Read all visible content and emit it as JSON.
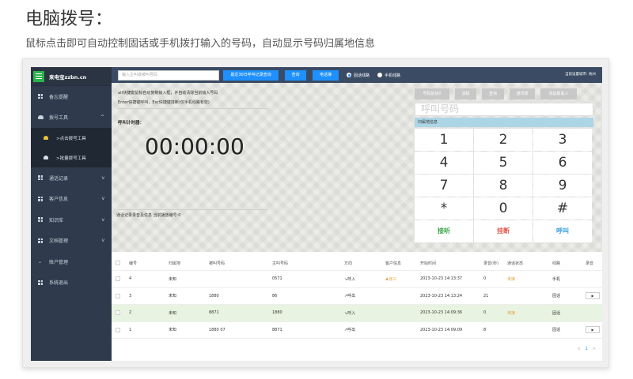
{
  "page": {
    "title": "电脑拨号：",
    "subtitle": "鼠标点击即可自动控制固话或手机拨打输入的号码，自动显示号码归属地信息"
  },
  "app": {
    "brand": "来电宝zzbn.cn",
    "sidebar": [
      {
        "label": "备忘提醒",
        "chev": ""
      },
      {
        "label": "拨号工具",
        "chev": "^"
      },
      {
        "label": ">点击拨号工具",
        "sub": true,
        "active": true
      },
      {
        "label": ">批量拨号工具",
        "sub": true
      },
      {
        "label": "通话记录",
        "chev": "v"
      },
      {
        "label": "客户信息",
        "chev": "v"
      },
      {
        "label": "知识库",
        "chev": "v"
      },
      {
        "label": "文档管理",
        "chev": "v"
      },
      {
        "label": "账户管理",
        "chev": ""
      },
      {
        "label": "系统退出",
        "chev": ""
      }
    ],
    "topbar": {
      "search_placeholder": "输入主叫或被叫号码",
      "btn_recent": "最近30日呼叫记录查询",
      "btn_query": "查询",
      "btn_board": "电话簿",
      "radio_landline": "固话线路",
      "radio_mobile": "手机线路",
      "right_text": "当前设置城市: 杭州"
    },
    "work": {
      "hint1": "alt快捷键鼠标自动复制输入框，并自动清除当前输入号码",
      "hint2": "Enter快捷键呼叫，Esc快捷键挂断(仅手机线路有效)",
      "timer_label": "呼叫计时器：",
      "timer": "00:00:00",
      "rec_info": "通话记录录音及信息 当前播放编号:0"
    },
    "dialpad": {
      "buttons": [
        "号码前加0",
        "清除",
        "查询",
        "通讯录",
        "添加联系人"
      ],
      "input_placeholder": "呼叫号码",
      "region_label": "归属地信息",
      "keys": [
        "1",
        "2",
        "3",
        "4",
        "5",
        "6",
        "7",
        "8",
        "9",
        "*",
        "0",
        "#"
      ],
      "answer": "接听",
      "hangup": "挂断",
      "call": "呼叫"
    },
    "table": {
      "headers": [
        "编号",
        "归属地",
        "被叫号码",
        "主叫号码",
        "方向",
        "客户信息",
        "开始时间",
        "录音(秒)",
        "通话状态",
        "线路",
        "录音"
      ],
      "rows": [
        {
          "no": "4",
          "region": "未知",
          "callee": "",
          "caller": "0571",
          "dir": "↘呼入",
          "customer": "♟张三",
          "start": "2023-10-23 14:13:37",
          "rec": "0",
          "status": "未接",
          "line": "手机",
          "play": ""
        },
        {
          "no": "3",
          "region": "未知",
          "callee": "1880",
          "caller": "86",
          "dir": "↗呼出",
          "customer": "",
          "start": "2023-10-23 14:13:24",
          "rec": "21",
          "status": "",
          "line": "固话",
          "play": "▶"
        },
        {
          "no": "2",
          "region": "未知",
          "callee": "8871",
          "caller": "1880",
          "dir": "↘呼入",
          "customer": "",
          "start": "2023-10-23 14:09:36",
          "rec": "0",
          "status": "未接",
          "line": "固话",
          "play": ""
        },
        {
          "no": "1",
          "region": "未知",
          "callee": "1880 07",
          "caller": "8871",
          "dir": "↗呼出",
          "customer": "",
          "start": "2023-10-23 14:09:09",
          "rec": "8",
          "status": "",
          "line": "固话",
          "play": "▶"
        }
      ]
    },
    "pager": {
      "prev": "<",
      "current": "1",
      "next": ">"
    }
  }
}
